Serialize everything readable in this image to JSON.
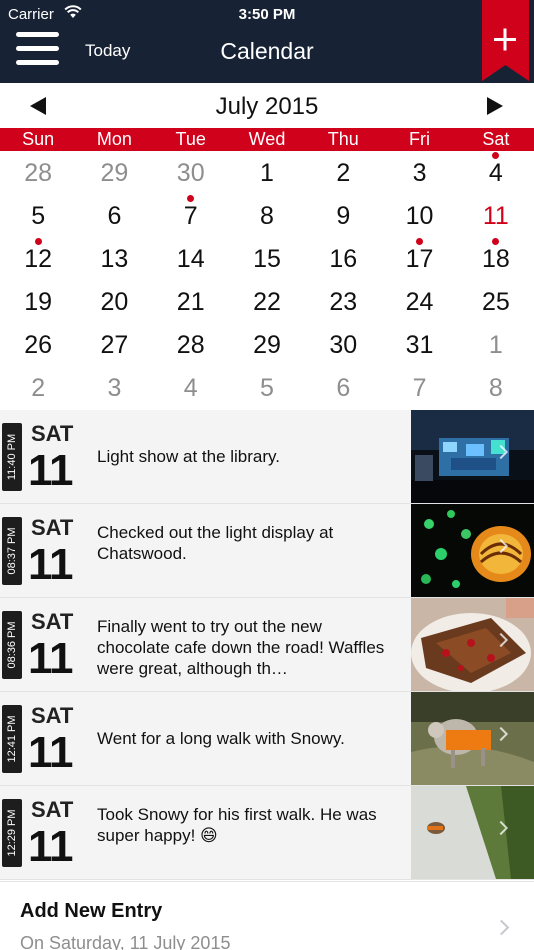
{
  "status_bar": {
    "carrier": "Carrier",
    "time": "3:50 PM"
  },
  "nav": {
    "today_label": "Today",
    "title": "Calendar",
    "add_symbol": "+"
  },
  "calendar": {
    "month_label": "July 2015",
    "weekdays": [
      "Sun",
      "Mon",
      "Tue",
      "Wed",
      "Thu",
      "Fri",
      "Sat"
    ],
    "days": [
      {
        "n": "28",
        "dim": true
      },
      {
        "n": "29",
        "dim": true
      },
      {
        "n": "30",
        "dim": true
      },
      {
        "n": "1"
      },
      {
        "n": "2"
      },
      {
        "n": "3"
      },
      {
        "n": "4",
        "dot": true
      },
      {
        "n": "5"
      },
      {
        "n": "6"
      },
      {
        "n": "7",
        "dot": true
      },
      {
        "n": "8"
      },
      {
        "n": "9"
      },
      {
        "n": "10"
      },
      {
        "n": "11",
        "today": true
      },
      {
        "n": "12",
        "dot": true
      },
      {
        "n": "13"
      },
      {
        "n": "14"
      },
      {
        "n": "15"
      },
      {
        "n": "16"
      },
      {
        "n": "17",
        "dot": true
      },
      {
        "n": "18",
        "dot": true
      },
      {
        "n": "19"
      },
      {
        "n": "20"
      },
      {
        "n": "21"
      },
      {
        "n": "22"
      },
      {
        "n": "23"
      },
      {
        "n": "24"
      },
      {
        "n": "25"
      },
      {
        "n": "26"
      },
      {
        "n": "27"
      },
      {
        "n": "28"
      },
      {
        "n": "29"
      },
      {
        "n": "30"
      },
      {
        "n": "31"
      },
      {
        "n": "1",
        "dim": true
      },
      {
        "n": "2",
        "dim": true
      },
      {
        "n": "3",
        "dim": true
      },
      {
        "n": "4",
        "dim": true
      },
      {
        "n": "5",
        "dim": true
      },
      {
        "n": "6",
        "dim": true
      },
      {
        "n": "7",
        "dim": true
      },
      {
        "n": "8",
        "dim": true
      }
    ]
  },
  "entries": [
    {
      "time": "11:40 PM",
      "dow": "SAT",
      "day": "11",
      "text": "Light show at the library.",
      "photo": "light-show-photo"
    },
    {
      "time": "08:37 PM",
      "dow": "SAT",
      "day": "11",
      "text": "Checked out the light display at Chatswood.",
      "photo": "lanterns-photo"
    },
    {
      "time": "08:36 PM",
      "dow": "SAT",
      "day": "11",
      "text": "Finally went to try out the new chocolate cafe down the road! Waffles were great, although th…",
      "photo": "waffles-photo"
    },
    {
      "time": "12:41 PM",
      "dow": "SAT",
      "day": "11",
      "text": "Went for a long walk with Snowy.",
      "photo": "dog-walk-photo"
    },
    {
      "time": "12:29 PM",
      "dow": "SAT",
      "day": "11",
      "text": "Took Snowy for his first walk. He was super happy! 😄",
      "photo": "dog-path-photo"
    }
  ],
  "add_entry": {
    "title": "Add New Entry",
    "subtitle": "On Saturday, 11 July 2015"
  },
  "colors": {
    "navbar": "#172335",
    "accent_red": "#d0021b"
  }
}
